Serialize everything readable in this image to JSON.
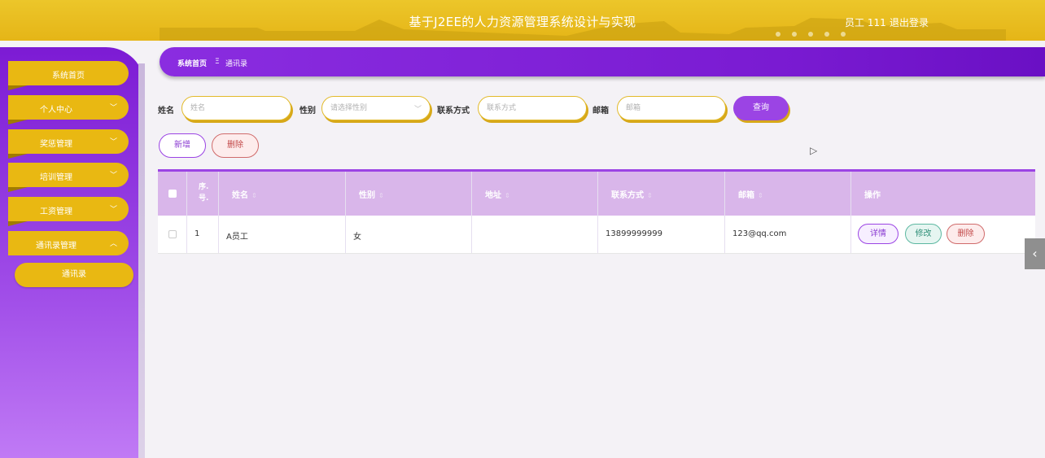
{
  "header": {
    "title": "基于J2EE的人力资源管理系统设计与实现",
    "user": "员工 111",
    "logout": "退出登录",
    "accent": "#e9b812"
  },
  "sidebar": {
    "items": [
      {
        "label": "系统首页",
        "has_chevron": false
      },
      {
        "label": "个人中心",
        "has_chevron": true
      },
      {
        "label": "奖惩管理",
        "has_chevron": true
      },
      {
        "label": "培训管理",
        "has_chevron": true
      },
      {
        "label": "工资管理",
        "has_chevron": true
      },
      {
        "label": "通讯录管理",
        "has_chevron": true,
        "expanded": true
      }
    ],
    "subitem": "通讯录",
    "chevron_down": "﹀",
    "chevron_up": "︿",
    "color": "#7c1bd4"
  },
  "breadcrumb": {
    "home": "系统首页",
    "separator": "Ξ",
    "current": "通讯录"
  },
  "search": {
    "name_label": "姓名",
    "name_placeholder": "姓名",
    "gender_label": "性别",
    "gender_placeholder": "请选择性别",
    "contact_label": "联系方式",
    "contact_placeholder": "联系方式",
    "email_label": "邮箱",
    "email_placeholder": "邮箱",
    "query": "查询"
  },
  "toolbar": {
    "add": "新增",
    "delete": "删除"
  },
  "table": {
    "seq_header": "序.\n号.",
    "seq_line1": "序.",
    "seq_line2": "号.",
    "headers": [
      "姓名",
      "性别",
      "地址",
      "联系方式",
      "邮箱",
      "操作"
    ],
    "sort_icon": "⇕",
    "rows": [
      {
        "seq": "1",
        "name": "A员工",
        "gender": "女",
        "address": "",
        "contact": "13899999999",
        "email": "123@qq.com"
      }
    ],
    "actions": {
      "detail": "详情",
      "edit": "修改",
      "delete": "删除"
    }
  },
  "collapse_glyph": "‹"
}
